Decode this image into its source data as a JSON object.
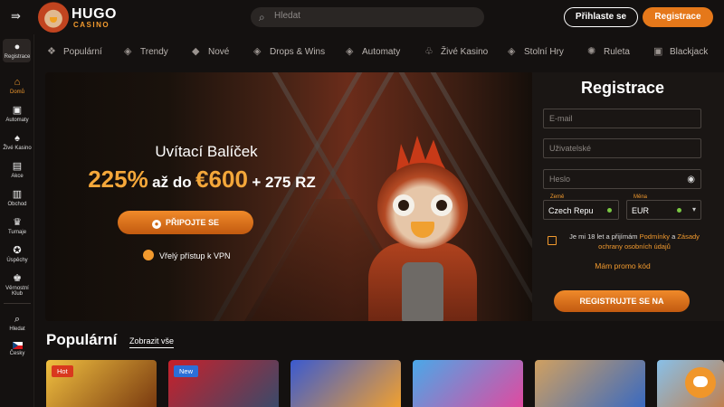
{
  "header": {
    "logo_top": "HUGO",
    "logo_bottom": "CASINO",
    "search_placeholder": "Hledat",
    "login_label": "Přihlaste se",
    "register_label": "Registrace"
  },
  "sidebar": {
    "items": [
      {
        "label": "Registrace",
        "icon": "user-icon",
        "active": false
      },
      {
        "label": "Domů",
        "icon": "home-icon",
        "active": true
      },
      {
        "label": "Automaty",
        "icon": "slot-icon",
        "active": false
      },
      {
        "label": "Živé Kasino",
        "icon": "cards-icon",
        "active": false
      },
      {
        "label": "Akce",
        "icon": "gift-icon",
        "active": false
      },
      {
        "label": "Obchod",
        "icon": "shop-icon",
        "active": false
      },
      {
        "label": "Turnaje",
        "icon": "trophy-icon",
        "active": false
      },
      {
        "label": "Úspěchy",
        "icon": "medal-icon",
        "active": false
      },
      {
        "label": "Věrnostní Klub",
        "icon": "crown-icon",
        "active": false
      },
      {
        "label": "Hledat",
        "icon": "search-icon",
        "active": false
      },
      {
        "label": "Česky",
        "icon": "flag-cz-icon",
        "active": false
      }
    ]
  },
  "categories": [
    {
      "label": "Populární",
      "icon": "popular-icon"
    },
    {
      "label": "Trendy",
      "icon": "trending-icon"
    },
    {
      "label": "Nové",
      "icon": "new-icon"
    },
    {
      "label": "Drops & Wins",
      "icon": "drops-icon"
    },
    {
      "label": "Automaty",
      "icon": "slot-icon"
    },
    {
      "label": "Živé Kasino",
      "icon": "live-icon"
    },
    {
      "label": "Stolní Hry",
      "icon": "table-games-icon"
    },
    {
      "label": "Ruleta",
      "icon": "roulette-icon"
    },
    {
      "label": "Blackjack",
      "icon": "blackjack-icon"
    }
  ],
  "hero": {
    "welcome": "Uvítací Balíček",
    "percent": "225%",
    "az_do": "až do",
    "amount": "€600",
    "extra": "+ 275 RZ",
    "cta": "PŘIPOJTE SE",
    "vpn": "Vřelý přístup k VPN"
  },
  "registration": {
    "title": "Registrace",
    "email_placeholder": "E-mail",
    "username_placeholder": "Uživatelské",
    "password_placeholder": "Heslo",
    "country_label": "Země",
    "country_value": "Czech Repu",
    "currency_label": "Měna",
    "currency_value": "EUR",
    "terms_prefix": "Je mi 18 let a přijímám",
    "terms_link1": "Podmínky",
    "terms_and": "a",
    "terms_link2": "Zásady ochrany osobních údajů",
    "promo": "Mám promo kód",
    "submit": "REGISTRUJTE SE NA"
  },
  "popular": {
    "title": "Populární",
    "show_all": "Zobrazit vše",
    "games": [
      {
        "badge": "Hot",
        "badge_color": "#d9381e",
        "color1": "#f0c040",
        "color2": "#7a3a10"
      },
      {
        "badge": "New",
        "badge_color": "#2b6fd8",
        "color1": "#c8202a",
        "color2": "#3a4a6a"
      },
      {
        "badge": "",
        "badge_color": "",
        "color1": "#3a5ad0",
        "color2": "#f0a030"
      },
      {
        "badge": "",
        "badge_color": "",
        "color1": "#4aa8e8",
        "color2": "#e04aa0"
      },
      {
        "badge": "",
        "badge_color": "",
        "color1": "#d0a060",
        "color2": "#3a6ac0"
      },
      {
        "badge": "",
        "badge_color": "",
        "color1": "#88c0e8",
        "color2": "#c08050"
      }
    ]
  },
  "colors": {
    "accent": "#e5781a",
    "background": "#141110",
    "panel": "#1a1614"
  }
}
